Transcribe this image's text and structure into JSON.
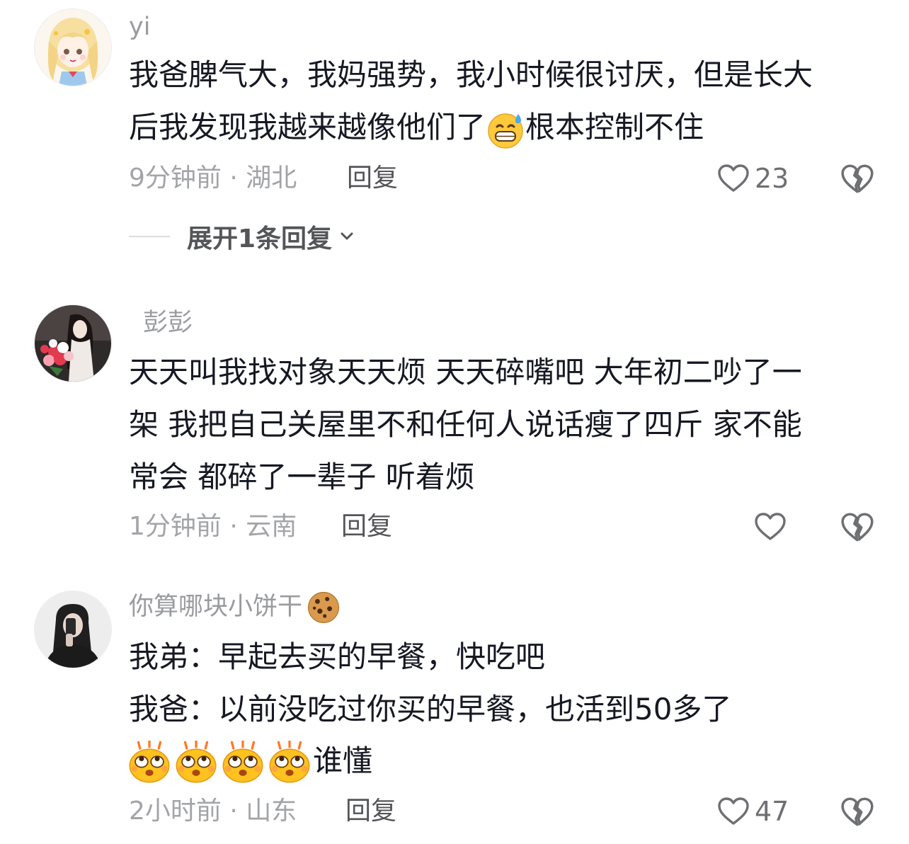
{
  "comments": [
    {
      "username": "yi",
      "lines": [
        "我爸脾气大，我妈强势，我小时候很讨厌，但是长大",
        "后我发现我越来越像他们了",
        "根本控制不住"
      ],
      "time_location": "9分钟前 · 湖北",
      "reply_label": "回复",
      "like_count": "23",
      "expand_label": "展开1条回复"
    },
    {
      "username": "彭彭",
      "lines": [
        "天天叫我找对象天天烦 天天碎嘴吧 大年初二吵了一",
        "架 我把自己关屋里不和任何人说话瘦了四斤 家不能",
        "常会 都碎了一辈子 听着烦"
      ],
      "time_location": "1分钟前 · 云南",
      "reply_label": "回复",
      "like_count": ""
    },
    {
      "username": "你算哪块小饼干",
      "lines": [
        "我弟：早起去买的早餐，快吃吧",
        "我爸：以前没吃过你买的早餐，也活到50多了",
        "谁懂"
      ],
      "time_location": "2小时前 · 山东",
      "reply_label": "回复",
      "like_count": "47"
    }
  ],
  "icons": {
    "like": "heart-outline-icon",
    "dislike": "broken-heart-icon",
    "expand": "chevron-down-icon",
    "emoji_sweat": "sweat-grin-emoji",
    "emoji_cookie": "cookie-emoji",
    "emoji_eyeroll": "eye-roll-emoji"
  },
  "colors": {
    "text": "#161823",
    "secondary": "#a3a4a8",
    "icon": "#6e6f73"
  }
}
